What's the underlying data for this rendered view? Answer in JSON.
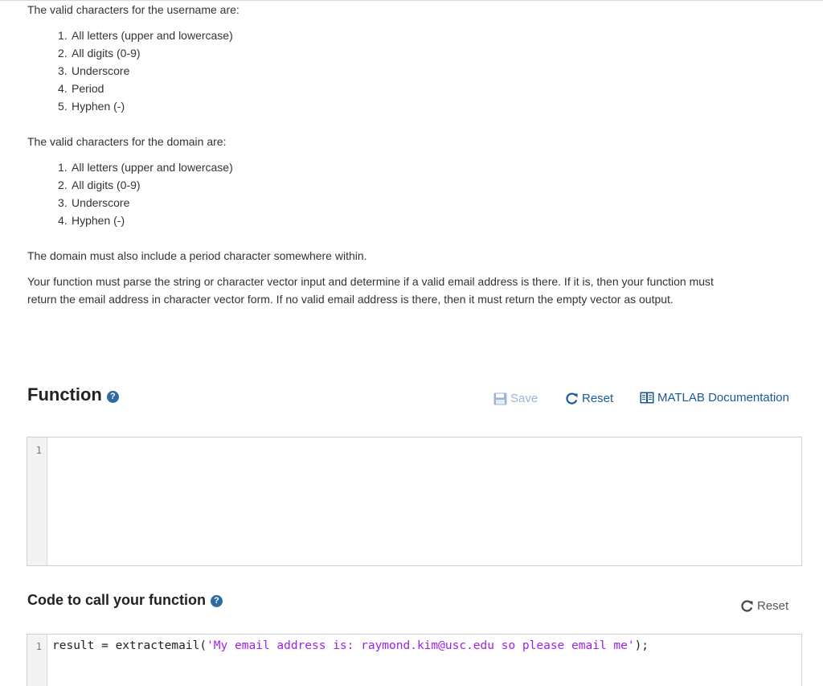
{
  "intro": {
    "username_heading": "The valid characters for the username are:",
    "username_items": [
      {
        "num": "1.",
        "text": "All letters (upper and lowercase)"
      },
      {
        "num": "2.",
        "text": "All digits (0-9)"
      },
      {
        "num": "3.",
        "text": "Underscore"
      },
      {
        "num": "4.",
        "text": "Period"
      },
      {
        "num": "5.",
        "text": "Hyphen (-)"
      }
    ],
    "domain_heading": "The valid characters for the domain are:",
    "domain_items": [
      {
        "num": "1.",
        "text": "All letters (upper and lowercase)"
      },
      {
        "num": "2.",
        "text": "All digits (0-9)"
      },
      {
        "num": "3.",
        "text": "Underscore"
      },
      {
        "num": "4.",
        "text": "Hyphen (-)"
      }
    ],
    "domain_note": "The domain must also include a period character somewhere within.",
    "description_line1": "Your function must parse the string or character vector input and determine if a valid email address is there. If it is, then your function must",
    "description_line2": "return the email address in character vector form. If no valid email address is there, then it must return the empty vector as output."
  },
  "function_section": {
    "title": "Function",
    "help_icon": "question-circle-icon",
    "save_label": "Save",
    "reset_label": "Reset",
    "docs_label": "MATLAB Documentation",
    "editor": {
      "line_numbers": [
        "1"
      ],
      "content": ""
    }
  },
  "call_section": {
    "title": "Code to call your function",
    "help_icon": "question-circle-icon",
    "reset_label": "Reset",
    "editor": {
      "line_numbers": [
        "1"
      ],
      "code_prefix": "result = extractemail(",
      "code_string": "'My email address is: raymond.kim@usc.edu so please email me'",
      "code_suffix": ");"
    }
  },
  "colors": {
    "accent": "#1a5a96",
    "help_icon": "#2e6aa0",
    "string": "#a020f0",
    "save_disabled": "#9bb6d2"
  }
}
